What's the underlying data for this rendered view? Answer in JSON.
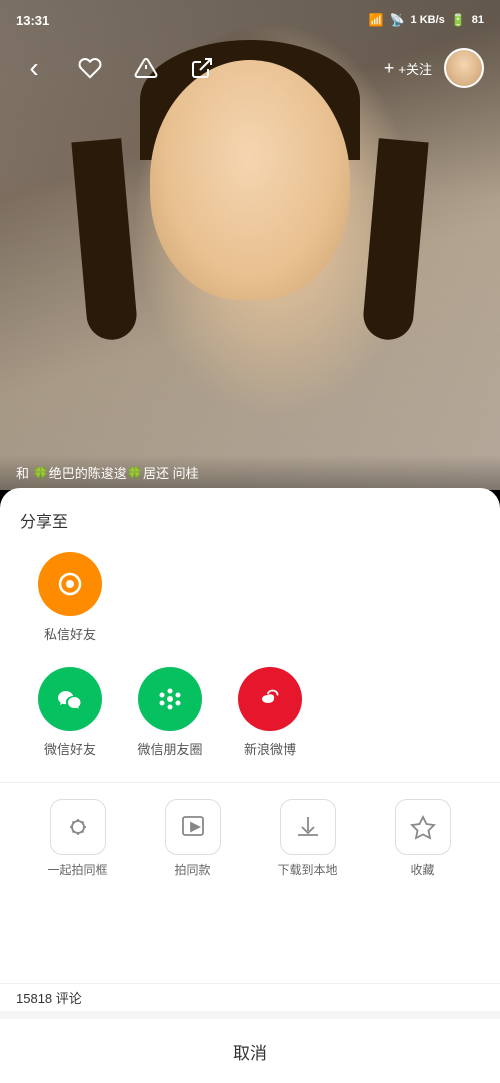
{
  "status_bar": {
    "time": "13:31",
    "signal": "信号",
    "wifi": "WiFi",
    "speed": "1 KB/s",
    "battery": "81"
  },
  "top_bar": {
    "follow_label": "+关注",
    "back_icon": "‹"
  },
  "video": {
    "overlay_text": "和 🍀绝巴的陈逡逡🍀居还 问桂"
  },
  "share_panel": {
    "title": "分享至",
    "private_message": {
      "label": "私信好友",
      "icon": "💬"
    },
    "social_items": [
      {
        "label": "微信好友",
        "color": "green",
        "icon": "💬"
      },
      {
        "label": "微信朋友圈",
        "color": "green",
        "icon": "⊙"
      },
      {
        "label": "新浪微博",
        "color": "weibo-orange",
        "icon": "微"
      }
    ],
    "action_items": [
      {
        "label": "一起拍同框",
        "icon": "😊"
      },
      {
        "label": "拍同款",
        "icon": "▷"
      },
      {
        "label": "下载到本地",
        "icon": "↓"
      },
      {
        "label": "收藏",
        "icon": "☆"
      }
    ]
  },
  "cancel_label": "取消",
  "comments": {
    "count_label": "15818 评论"
  }
}
